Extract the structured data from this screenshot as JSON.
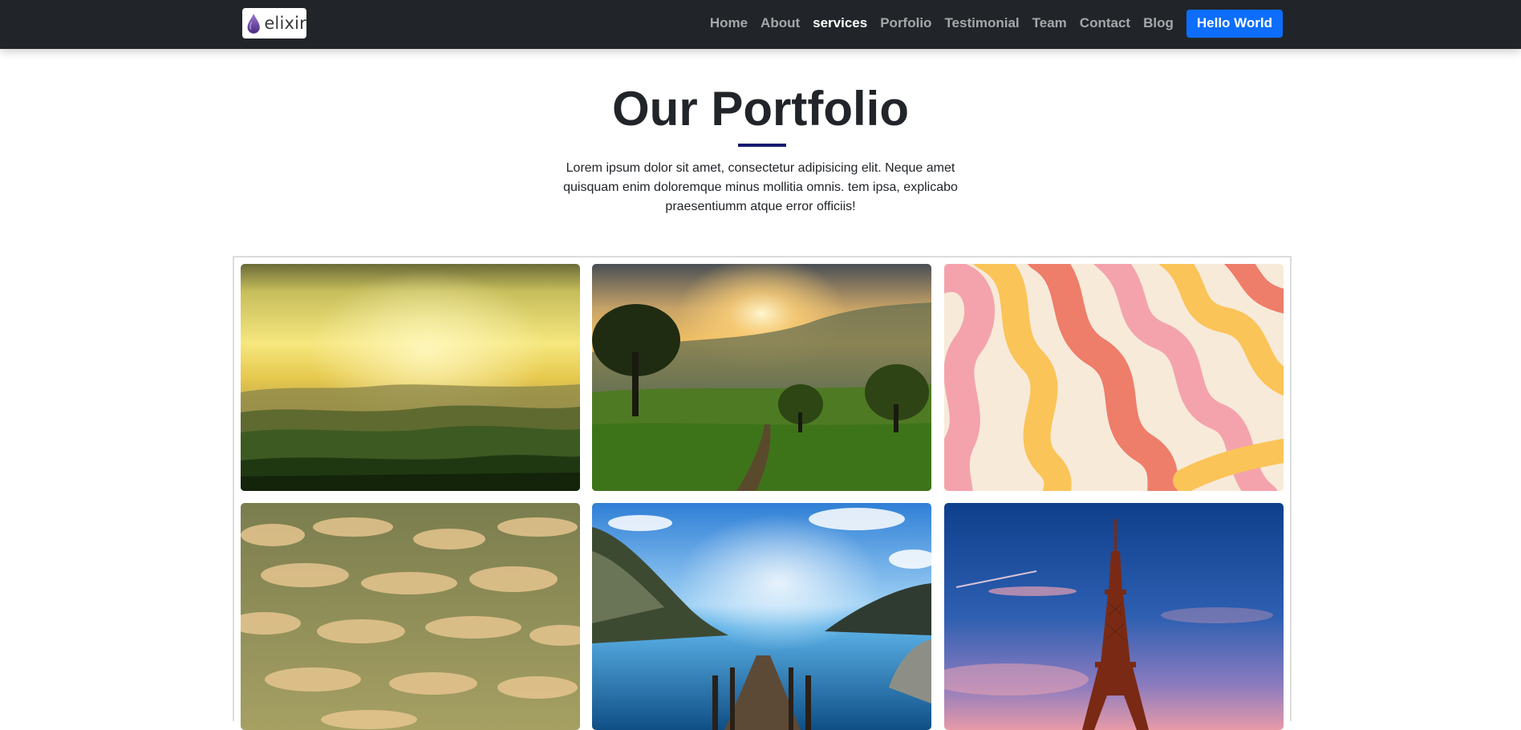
{
  "brand": {
    "name": "elixir",
    "icon": "elixir-drop-logo"
  },
  "nav": {
    "items": [
      {
        "label": "Home",
        "active": false
      },
      {
        "label": "About",
        "active": false
      },
      {
        "label": "services",
        "active": true
      },
      {
        "label": "Porfolio",
        "active": false
      },
      {
        "label": "Testimonial",
        "active": false
      },
      {
        "label": "Team",
        "active": false
      },
      {
        "label": "Contact",
        "active": false
      },
      {
        "label": "Blog",
        "active": false
      }
    ],
    "cta_label": "Hello World"
  },
  "portfolio": {
    "title": "Our Portfolio",
    "description": "Lorem ipsum dolor sit amet, consectetur adipisicing elit. Neque amet quisquam enim doloremque minus mollitia omnis. tem ipsa, explicabo praesentiumm atque error officiis!",
    "images": [
      {
        "subject": "golden-hills-sunset"
      },
      {
        "subject": "sunrise-meadow-trees"
      },
      {
        "subject": "pink-orange-wavy-pattern"
      },
      {
        "subject": "cloudy-golden-sky"
      },
      {
        "subject": "wooden-pier-lake-cliffs"
      },
      {
        "subject": "eiffel-tower-dusk"
      }
    ]
  },
  "colors": {
    "navbar_bg": "#212529",
    "nav_link": "#a6a7a9",
    "nav_link_active": "#ffffff",
    "cta_bg": "#0d6efd",
    "title_underline": "#141a6e"
  }
}
